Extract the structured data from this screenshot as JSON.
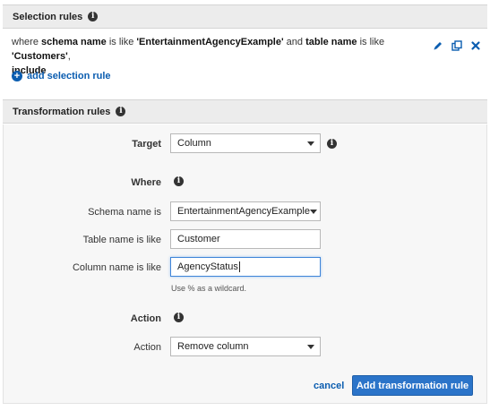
{
  "selection_rules": {
    "header": "Selection rules",
    "rule": {
      "prefix": "where ",
      "schema_label": "schema name",
      "is_like_1": " is like ",
      "schema_value": "'EntertainmentAgencyExample'",
      "and_text": " and ",
      "table_label": "table name",
      "is_like_2": " is like ",
      "table_value": "'Customers'",
      "comma": ",",
      "action": "include"
    },
    "add_label": "add selection rule",
    "icons": [
      "edit-icon",
      "copy-icon",
      "delete-icon"
    ]
  },
  "transformation_rules": {
    "header": "Transformation rules",
    "target": {
      "label": "Target",
      "value": "Column"
    },
    "where": {
      "label": "Where"
    },
    "schema_name": {
      "label": "Schema name is",
      "value": "EntertainmentAgencyExample"
    },
    "table_name": {
      "label": "Table name is like",
      "value": "Customer"
    },
    "column_name": {
      "label": "Column name is like",
      "value": "AgencyStatus"
    },
    "wildcard_hint": "Use % as a wildcard.",
    "action_section": {
      "label": "Action"
    },
    "action": {
      "label": "Action",
      "value": "Remove column"
    },
    "cancel_label": "cancel",
    "submit_label": "Add transformation rule"
  },
  "colors": {
    "link": "#0b5db0",
    "primary_button": "#2b74c9",
    "header_bg": "#ececec"
  }
}
